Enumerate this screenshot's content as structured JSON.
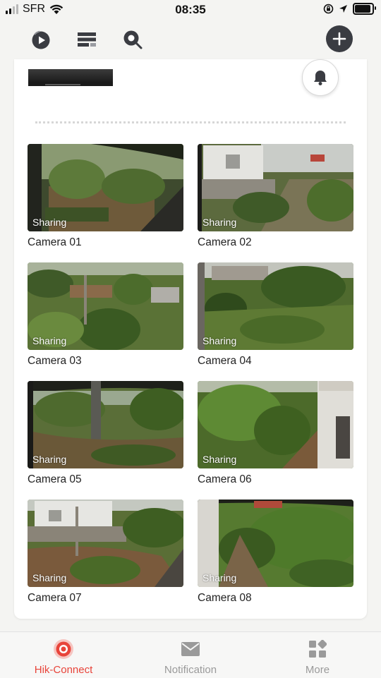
{
  "status_bar": {
    "carrier": "SFR",
    "time": "08:35"
  },
  "device": {
    "name_hidden": true
  },
  "cameras": [
    {
      "label": "Camera 01",
      "badge": "Sharing"
    },
    {
      "label": "Camera 02",
      "badge": "Sharing"
    },
    {
      "label": "Camera 03",
      "badge": "Sharing"
    },
    {
      "label": "Camera 04",
      "badge": "Sharing"
    },
    {
      "label": "Camera 05",
      "badge": "Sharing"
    },
    {
      "label": "Camera 06",
      "badge": "Sharing"
    },
    {
      "label": "Camera 07",
      "badge": "Sharing"
    },
    {
      "label": "Camera 08",
      "badge": "Sharing"
    }
  ],
  "tabs": [
    {
      "label": "Hik-Connect",
      "icon": "camera-lens-icon",
      "active": true
    },
    {
      "label": "Notification",
      "icon": "envelope-icon",
      "active": false
    },
    {
      "label": "More",
      "icon": "grid-apps-icon",
      "active": false
    }
  ],
  "colors": {
    "accent": "#e8443a",
    "dark_icon": "#3a3c42",
    "background": "#f4f4f2"
  }
}
